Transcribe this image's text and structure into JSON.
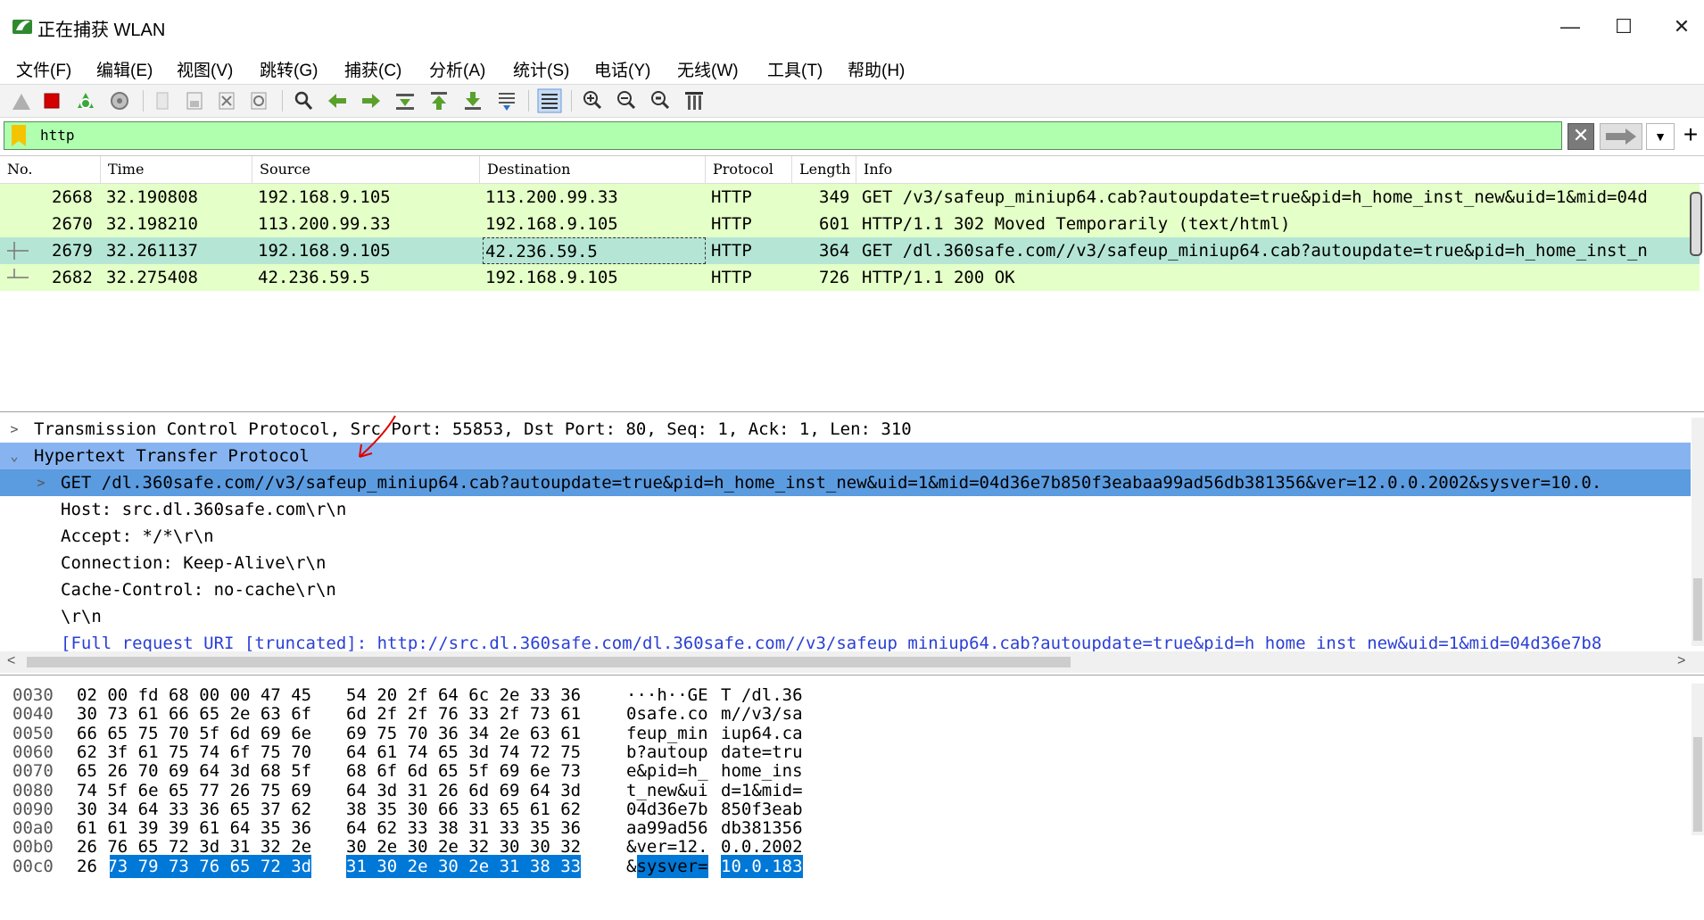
{
  "window": {
    "title": "正在捕获 WLAN",
    "minimize": "—",
    "maximize": "☐",
    "close": "✕"
  },
  "menu": [
    "文件(F)",
    "编辑(E)",
    "视图(V)",
    "跳转(G)",
    "捕获(C)",
    "分析(A)",
    "统计(S)",
    "电话(Y)",
    "无线(W)",
    "工具(T)",
    "帮助(H)"
  ],
  "colors": {
    "http_row": "#e4ffc7",
    "selected_row": "#b5e6d5",
    "detail_highlight": "#87b4f0",
    "detail_selected": "#5b9be0",
    "bytes_highlight": "#0078d7",
    "filter_bg": "#afffaf"
  },
  "filter": {
    "value": "http"
  },
  "packet_list": {
    "columns": [
      "No.",
      "Time",
      "Source",
      "Destination",
      "Protocol",
      "Length",
      "Info"
    ],
    "rows": [
      {
        "no": "2668",
        "time": "32.190808",
        "src": "192.168.9.105",
        "dst": "113.200.99.33",
        "proto": "HTTP",
        "len": "349",
        "info": "GET /v3/safeup_miniup64.cab?autoupdate=true&pid=h_home_inst_new&uid=1&mid=04d"
      },
      {
        "no": "2670",
        "time": "32.198210",
        "src": "113.200.99.33",
        "dst": "192.168.9.105",
        "proto": "HTTP",
        "len": "601",
        "info": "HTTP/1.1 302 Moved Temporarily  (text/html)"
      },
      {
        "no": "2679",
        "time": "32.261137",
        "src": "192.168.9.105",
        "dst": "42.236.59.5",
        "proto": "HTTP",
        "len": "364",
        "info": "GET /dl.360safe.com//v3/safeup_miniup64.cab?autoupdate=true&pid=h_home_inst_n"
      },
      {
        "no": "2682",
        "time": "32.275408",
        "src": "42.236.59.5",
        "dst": "192.168.9.105",
        "proto": "HTTP",
        "len": "726",
        "info": "HTTP/1.1 200 OK"
      }
    ]
  },
  "details": {
    "rows": [
      {
        "text": "Transmission Control Protocol, Src Port: 55853, Dst Port: 80, Seq: 1, Ack: 1, Len: 310",
        "arrow": ">",
        "indent": 0
      },
      {
        "text": "Hypertext Transfer Protocol",
        "arrow": "v",
        "indent": 0
      },
      {
        "text": "GET /dl.360safe.com//v3/safeup_miniup64.cab?autoupdate=true&pid=h_home_inst_new&uid=1&mid=04d36e7b850f3eabaa99ad56db381356&ver=12.0.0.2002&sysver=10.0.",
        "arrow": ">",
        "indent": 1
      },
      {
        "text": "Host: src.dl.360safe.com\\r\\n",
        "arrow": "",
        "indent": 1
      },
      {
        "text": "Accept: */*\\r\\n",
        "arrow": "",
        "indent": 1
      },
      {
        "text": "Connection: Keep-Alive\\r\\n",
        "arrow": "",
        "indent": 1
      },
      {
        "text": "Cache-Control: no-cache\\r\\n",
        "arrow": "",
        "indent": 1
      },
      {
        "text": "\\r\\n",
        "arrow": "",
        "indent": 1
      },
      {
        "text": "[Full request URI [truncated]: http://src.dl.360safe.com/dl.360safe.com//v3/safeup_miniup64.cab?autoupdate=true&pid=h_home_inst_new&uid=1&mid=04d36e7b8",
        "arrow": "",
        "indent": 1
      }
    ]
  },
  "bytes": {
    "rows": [
      {
        "off": "0030",
        "hex1": "02 00 fd 68 00 00 47 45",
        "hex2": "54 20 2f 64 6c 2e 33 36",
        "asc1": "···h··GE",
        "asc2": "T /dl.36"
      },
      {
        "off": "0040",
        "hex1": "30 73 61 66 65 2e 63 6f",
        "hex2": "6d 2f 2f 76 33 2f 73 61",
        "asc1": "0safe.co",
        "asc2": "m//v3/sa"
      },
      {
        "off": "0050",
        "hex1": "66 65 75 70 5f 6d 69 6e",
        "hex2": "69 75 70 36 34 2e 63 61",
        "asc1": "feup_min",
        "asc2": "iup64.ca"
      },
      {
        "off": "0060",
        "hex1": "62 3f 61 75 74 6f 75 70",
        "hex2": "64 61 74 65 3d 74 72 75",
        "asc1": "b?autoup",
        "asc2": "date=tru"
      },
      {
        "off": "0070",
        "hex1": "65 26 70 69 64 3d 68 5f",
        "hex2": "68 6f 6d 65 5f 69 6e 73",
        "asc1": "e&pid=h_",
        "asc2": "home_ins"
      },
      {
        "off": "0080",
        "hex1": "74 5f 6e 65 77 26 75 69",
        "hex2": "64 3d 31 26 6d 69 64 3d",
        "asc1": "t_new&ui",
        "asc2": "d=1&mid="
      },
      {
        "off": "0090",
        "hex1": "30 34 64 33 36 65 37 62",
        "hex2": "38 35 30 66 33 65 61 62",
        "asc1": "04d36e7b",
        "asc2": "850f3eab"
      },
      {
        "off": "00a0",
        "hex1": "61 61 39 39 61 64 35 36",
        "hex2": "64 62 33 38 31 33 35 36",
        "asc1": "aa99ad56",
        "asc2": "db381356"
      },
      {
        "off": "00b0",
        "hex1": "26 76 65 72 3d 31 32 2e",
        "hex2": "30 2e 30 2e 32 30 30 32",
        "asc1": "&ver=12.",
        "asc2": "0.0.2002"
      },
      {
        "off": "00c0",
        "hex1": "26 73 79 73 76 65 72 3d",
        "hex2": "31 30 2e 30 2e 31 38 33",
        "asc1": "&sysver=",
        "asc2": "10.0.183"
      }
    ]
  }
}
